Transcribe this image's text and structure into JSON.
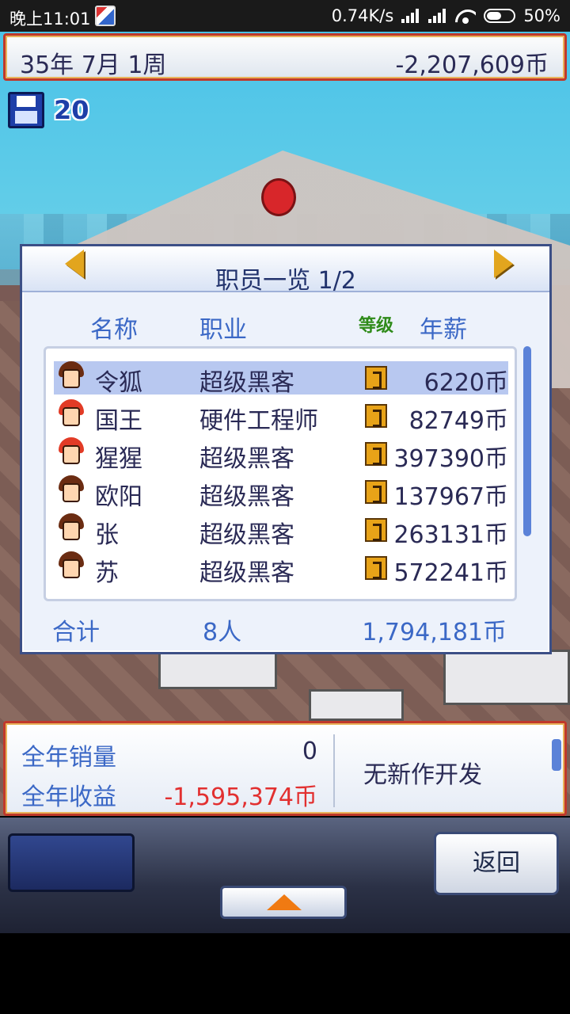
{
  "status_bar": {
    "time": "晚上11:01",
    "net_speed": "0.74K/s",
    "battery": "50%"
  },
  "top_bar": {
    "date": "35年 7月 1周",
    "money": "-2,207,609币"
  },
  "save_count": "20",
  "staff_dialog": {
    "title": "职员一览 1/2",
    "columns": {
      "name": "名称",
      "job": "职业",
      "level": "等级",
      "salary": "年薪"
    },
    "rows": [
      {
        "name": "令狐",
        "job": "超级黑客",
        "salary": "6220币",
        "selected": true
      },
      {
        "name": "国王",
        "job": "硬件工程师",
        "salary": "82749币"
      },
      {
        "name": "猩猩",
        "job": "超级黑客",
        "salary": "397390币"
      },
      {
        "name": "欧阳",
        "job": "超级黑客",
        "salary": "137967币"
      },
      {
        "name": "张",
        "job": "超级黑客",
        "salary": "263131币"
      },
      {
        "name": "苏",
        "job": "超级黑客",
        "salary": "572241币"
      }
    ],
    "total_label": "合计",
    "total_people": "8人",
    "total_salary": "1,794,181币"
  },
  "info_bar": {
    "annual_sales_label": "全年销量",
    "annual_sales_value": "0",
    "annual_profit_label": "全年收益",
    "annual_profit_value": "-1,595,374币",
    "news": "无新作开发"
  },
  "controls": {
    "back_label": "返回"
  },
  "colors": {
    "accent_blue": "#3b68c6",
    "negative_red": "#e23030",
    "frame_red": "#c0392b",
    "level_gold": "#e8a318"
  },
  "icons": [
    "app-icon",
    "cell-signal-icon",
    "wifi-icon",
    "battery-icon",
    "floppy-disk-icon",
    "left-arrow-icon",
    "right-arrow-icon",
    "level-badge-icon",
    "up-arrow-icon"
  ]
}
